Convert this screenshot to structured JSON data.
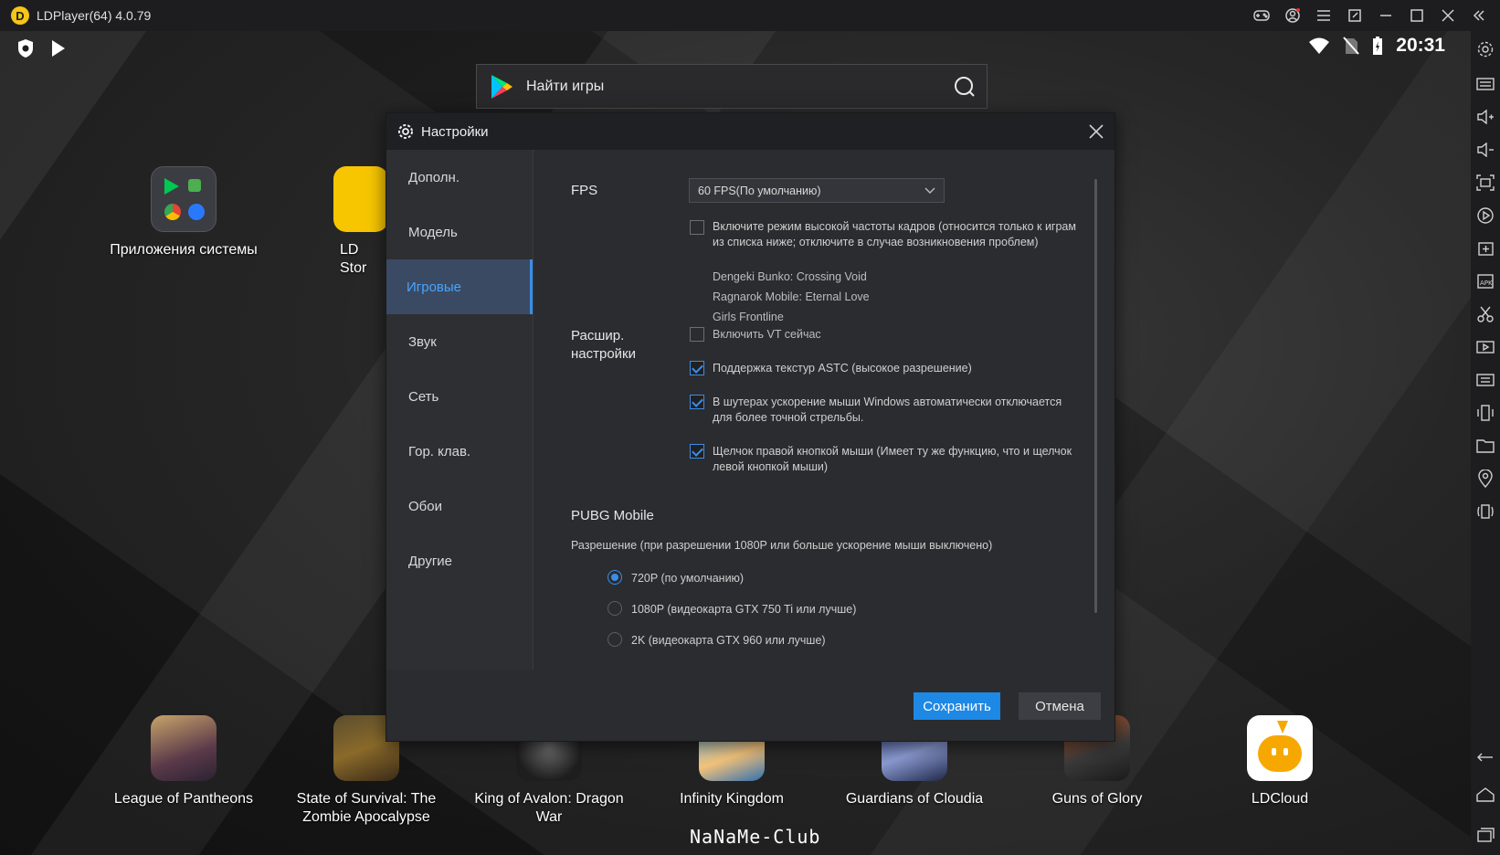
{
  "window": {
    "title": "LDPlayer(64) 4.0.79"
  },
  "statusbar": {
    "time": "20:31"
  },
  "search": {
    "placeholder": "Найти игры"
  },
  "desktop_top": [
    {
      "label": "Приложения системы"
    },
    {
      "label": "LD Stor"
    }
  ],
  "desktop_bottom": [
    {
      "label": "League of Pantheons"
    },
    {
      "label": "State of Survival: The Zombie Apocalypse"
    },
    {
      "label": "King of Avalon: Dragon War"
    },
    {
      "label": "Infinity Kingdom"
    },
    {
      "label": "Guardians of Cloudia"
    },
    {
      "label": "Guns of Glory"
    },
    {
      "label": "LDCloud"
    }
  ],
  "settings": {
    "title": "Настройки",
    "nav": [
      "Дополн.",
      "Модель",
      "Игровые",
      "Звук",
      "Сеть",
      "Гор. клав.",
      "Обои",
      "Другие"
    ],
    "active_nav": "Игровые",
    "fps_label": "FPS",
    "fps_value": "60 FPS(По умолчанию)",
    "hfr_text": "Включите режим высокой частоты кадров (относится только к играм из списка ниже; отключите в случае возникновения проблем)",
    "hfr_checked": false,
    "games": [
      "Dengeki Bunko: Crossing Void",
      "Ragnarok Mobile: Eternal Love",
      "Girls Frontline"
    ],
    "advanced_label": "Расшир. настройки",
    "vt_text": "Включить VT сейчас",
    "vt_checked": false,
    "astc_text": "Поддержка текстур ASTC (высокое разрешение)",
    "astc_checked": true,
    "mouse_accel_text": "В шутерах ускорение мыши Windows автоматически отключается для более точной стрельбы.",
    "mouse_accel_checked": true,
    "right_click_text": "Щелчок правой кнопкой мыши (Имеет ту же функцию, что и щелчок левой кнопкой мыши)",
    "right_click_checked": true,
    "pubg_title": "PUBG Mobile",
    "resolution_label": "Разрешение (при разрешении 1080P или больше ускорение мыши выключено)",
    "resolutions": [
      "720P (по умолчанию)",
      "1080P (видеокарта GTX 750 Ti или лучше)",
      "2K (видеокарта GTX 960 или лучше)"
    ],
    "resolution_selected": "720P (по умолчанию)",
    "save_label": "Сохранить",
    "cancel_label": "Отмена"
  },
  "watermark": "NaNaMe-Club",
  "colors": {
    "accent": "#1e88e5",
    "titlebar": "#1d1d1f",
    "dialog": "#2b2c30"
  }
}
